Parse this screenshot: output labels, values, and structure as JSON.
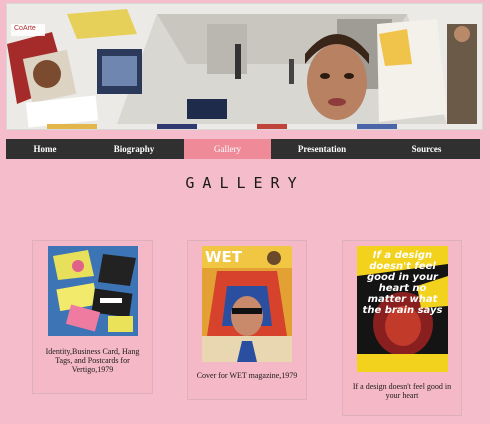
{
  "banner": {
    "logo_text": "CoArte"
  },
  "nav": {
    "items": [
      {
        "label": "Home"
      },
      {
        "label": "Biography"
      },
      {
        "label": "Gallery"
      },
      {
        "label": "Presentation"
      },
      {
        "label": "Sources"
      }
    ],
    "active": "Gallery"
  },
  "page_title": "GALLERY",
  "gallery": [
    {
      "caption": "Identity,Business Card, Hang Tags, and Postcards for Vertigo,1979"
    },
    {
      "caption": "Cover for WET magazine,1979",
      "art_text": "WET"
    },
    {
      "caption": "If a design doesn't feel good in your heart",
      "art_text": "If a design doesn't feel good in your heart no matter what the brain says"
    }
  ],
  "colors": {
    "background": "#f5bccb",
    "nav": "#303030",
    "nav_active": "#ef8a99"
  }
}
